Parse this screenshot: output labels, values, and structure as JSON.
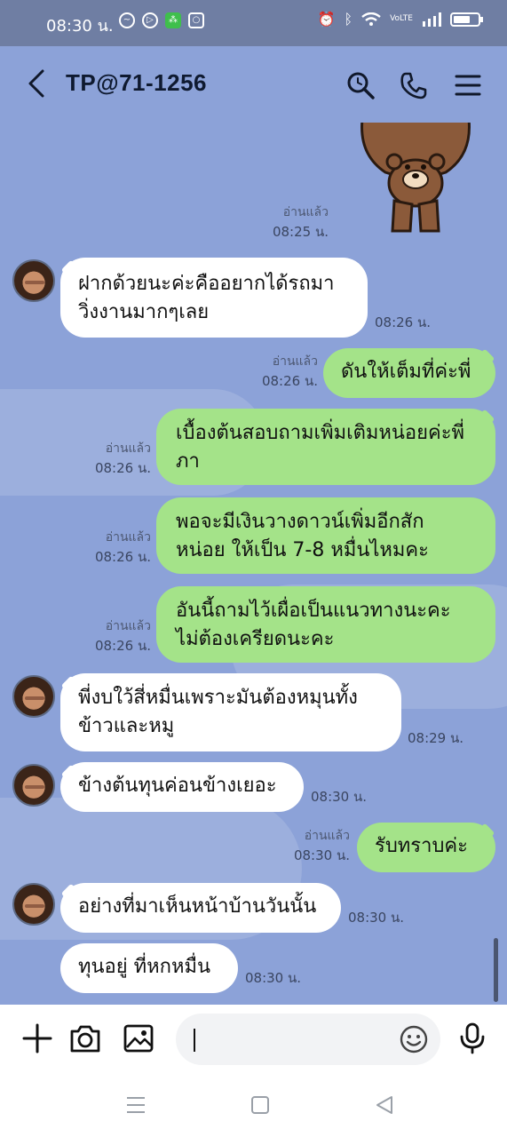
{
  "status_bar": {
    "time": "08:30 น.",
    "network": "VoLTE"
  },
  "header": {
    "title": "TP@71-1256"
  },
  "messages": [
    {
      "side": "out",
      "read": "อ่านแล้ว",
      "time": "08:25 น.",
      "type": "sticker"
    },
    {
      "side": "in",
      "text": [
        "ฝากด้วยนะค่ะคืออยากได้รถมา",
        "วิ่งงานมากๆเลย"
      ],
      "time": "08:26 น."
    },
    {
      "side": "out",
      "text": [
        "ดันให้เต็มที่ค่ะพี่"
      ],
      "read": "อ่านแล้ว",
      "time": "08:26 น."
    },
    {
      "side": "out",
      "text": [
        "เบื้องต้นสอบถามเพิ่มเติมหน่อยค่ะพี่",
        "ภา"
      ],
      "read": "อ่านแล้ว",
      "time": "08:26 น."
    },
    {
      "side": "out",
      "text": [
        "พอจะมีเงินวางดาวน์เพิ่มอีกสัก",
        "หน่อย ให้เป็น 7-8 หมื่นไหมคะ"
      ],
      "read": "อ่านแล้ว",
      "time": "08:26 น."
    },
    {
      "side": "out",
      "text": [
        "อันนี้ถามไว้เผื่อเป็นแนวทางนะคะ",
        "ไม่ต้องเครียดนะคะ"
      ],
      "read": "อ่านแล้ว",
      "time": "08:26 น."
    },
    {
      "side": "in",
      "text": [
        "พี่งบใว้สี่หมื่นเพราะมันต้องหมุนทั้ง",
        "ข้าวและหมู"
      ],
      "time": "08:29 น."
    },
    {
      "side": "in",
      "text": [
        "ข้างต้นทุนค่อนข้างเยอะ"
      ],
      "time": "08:30 น."
    },
    {
      "side": "out",
      "text": [
        "รับทราบค่ะ"
      ],
      "read": "อ่านแล้ว",
      "time": "08:30 น."
    },
    {
      "side": "in",
      "text": [
        "อย่างที่มาเห็นหน้าบ้านวันนั้น"
      ],
      "time": "08:30 น."
    },
    {
      "side": "in",
      "text": [
        "ทุนอยู่ ที่หกหมื่น"
      ],
      "time": "08:30 น."
    }
  ],
  "input": {
    "value": "",
    "placeholder": ""
  },
  "colors": {
    "chat_background": "#8ca2d8",
    "outgoing_bubble": "#a4e389",
    "incoming_bubble": "#ffffff",
    "status_bar": "#6f7ea3"
  },
  "icons": [
    "back-arrow-icon",
    "search-icon",
    "phone-icon",
    "menu-icon",
    "plus-icon",
    "camera-icon",
    "image-icon",
    "emoji-icon",
    "mic-icon"
  ]
}
